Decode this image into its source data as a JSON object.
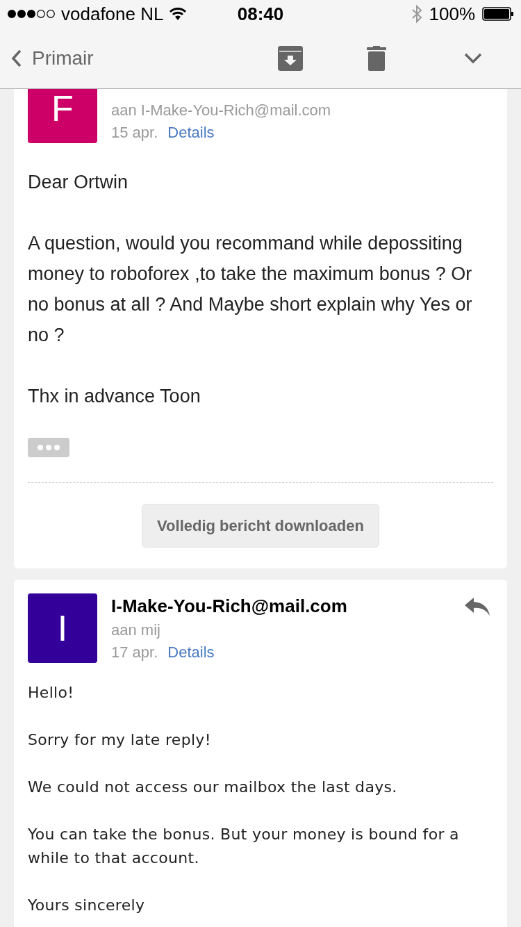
{
  "status_bar": {
    "carrier": "vodafone NL",
    "time": "08:40",
    "battery": "100%"
  },
  "nav_bar": {
    "back_label": "Primair"
  },
  "messages": [
    {
      "kind": "plain",
      "avatar_letter": "F",
      "color": "#cc0066",
      "recipient": "aan I-Make-You-Rich@mail.com",
      "date": "15 apr.",
      "details_link": "Details",
      "paragraphs": [
        "Dear Ortwin",
        "A question, would you recommand while depossiting money to roboforex ,to take the maximum bonus ? Or no bonus at all ? And Maybe short explain why Yes or no ?",
        "Thx in advance Toon"
      ],
      "download_button": "Volledig bericht downloaden"
    },
    {
      "kind": "html",
      "avatar_letter": "I",
      "color": "#330099",
      "sender": "I-Make-You-Rich@mail.com",
      "recipient": "aan mij",
      "date": "17 apr.",
      "details_link": "Details",
      "paragraphs": [
        "Hello!",
        "Sorry for my late reply!",
        "We could not access our mailbox the last days.",
        "You can take the bonus. But your money is bound for a while to that account.",
        "Yours sincerely"
      ]
    }
  ]
}
